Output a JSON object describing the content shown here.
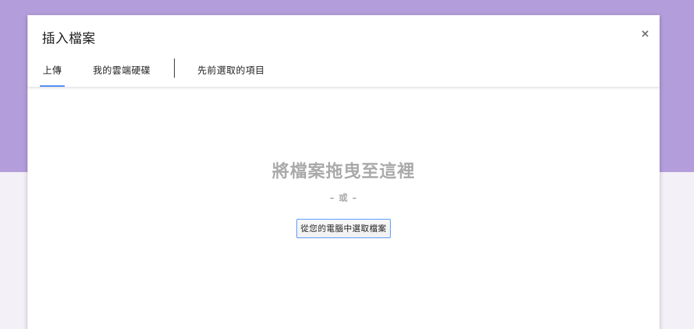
{
  "dialog": {
    "title": "插入檔案",
    "close_label": "×"
  },
  "tabs": [
    {
      "label": "上傳",
      "active": true
    },
    {
      "label": "我的雲端硬碟",
      "active": false
    },
    {
      "label": "先前選取的項目",
      "active": false
    }
  ],
  "upload": {
    "drop_text": "將檔案拖曳至這裡",
    "or_text": "– 或 –",
    "pick_button_label": "從您的電腦中選取檔案"
  },
  "colors": {
    "background_top": "#b39ddb",
    "background_bottom": "#f3f0f7",
    "active_tab_underline": "#4285f4",
    "button_border": "#4d90fe"
  }
}
